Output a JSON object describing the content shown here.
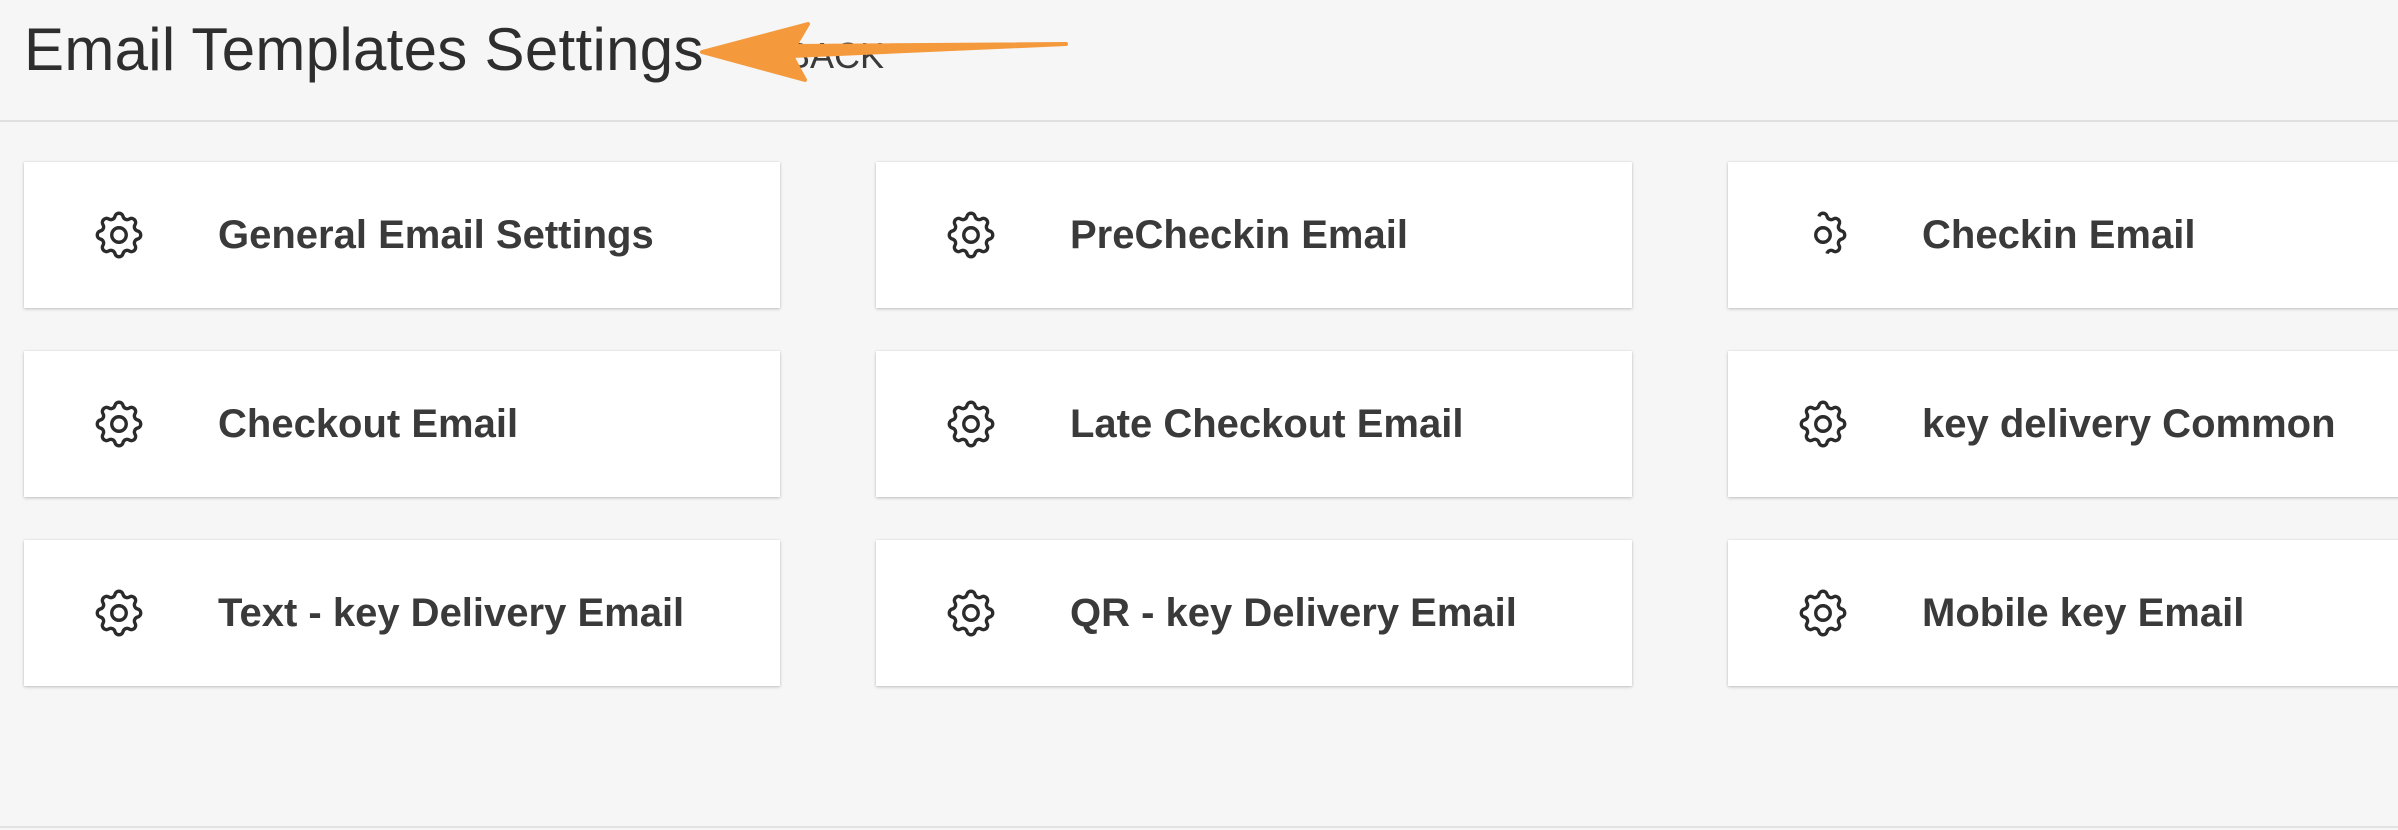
{
  "header": {
    "title": "Email Templates Settings",
    "back_label": "BACK"
  },
  "annotation": {
    "arrow_color": "#f49a3c"
  },
  "cards": [
    {
      "label": "General Email Settings",
      "icon": "gear-icon"
    },
    {
      "label": "PreCheckin Email",
      "icon": "gear-icon"
    },
    {
      "label": "Checkin Email",
      "icon": "gear-icon"
    },
    {
      "label": "Checkout Email",
      "icon": "gear-icon"
    },
    {
      "label": "Late Checkout Email",
      "icon": "gear-icon"
    },
    {
      "label": "key delivery Common",
      "icon": "gear-icon"
    },
    {
      "label": "Text - key Delivery Email",
      "icon": "gear-icon"
    },
    {
      "label": "QR - key Delivery Email",
      "icon": "gear-icon"
    },
    {
      "label": "Mobile key Email",
      "icon": "gear-icon"
    }
  ]
}
